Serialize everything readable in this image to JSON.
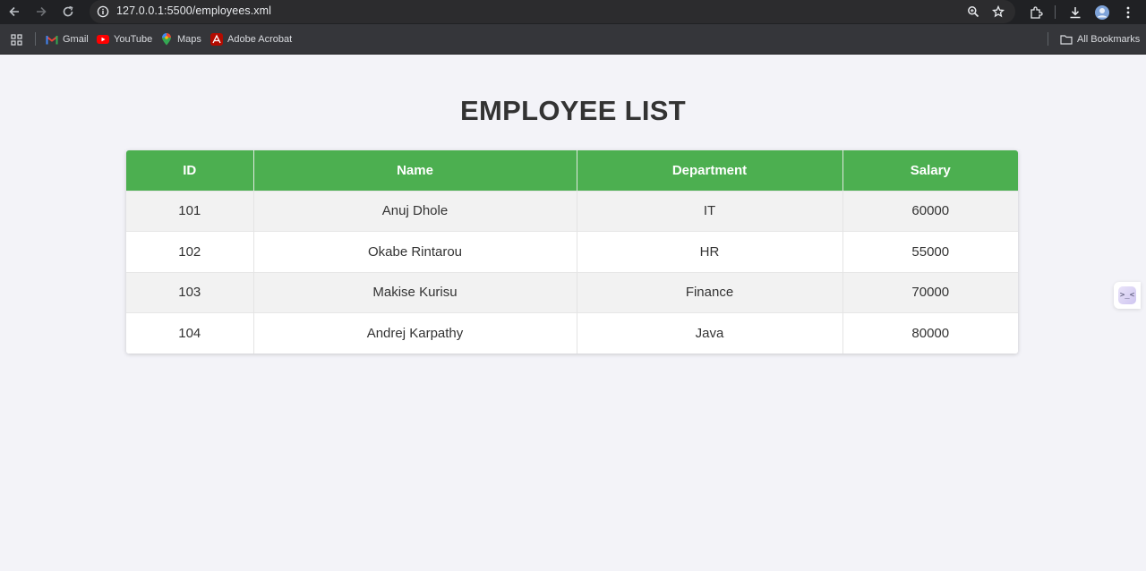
{
  "browser": {
    "url": "127.0.0.1:5500/employees.xml",
    "bookmarks": [
      {
        "label": "Gmail",
        "icon": "gmail-icon"
      },
      {
        "label": "YouTube",
        "icon": "youtube-icon"
      },
      {
        "label": "Maps",
        "icon": "maps-icon"
      },
      {
        "label": "Adobe Acrobat",
        "icon": "acrobat-icon"
      }
    ],
    "all_bookmarks_label": "All Bookmarks"
  },
  "page": {
    "title": "EMPLOYEE LIST",
    "table": {
      "headers": [
        "ID",
        "Name",
        "Department",
        "Salary"
      ],
      "rows": [
        [
          "101",
          "Anuj Dhole",
          "IT",
          "60000"
        ],
        [
          "102",
          "Okabe Rintarou",
          "HR",
          "55000"
        ],
        [
          "103",
          "Makise Kurisu",
          "Finance",
          "70000"
        ],
        [
          "104",
          "Andrej Karpathy",
          "Java",
          "80000"
        ]
      ]
    },
    "side_widget_glyph": ">_<"
  },
  "colors": {
    "header_green": "#4caf50",
    "page_background": "#f3f3f8",
    "striped_row": "#f2f2f2"
  }
}
